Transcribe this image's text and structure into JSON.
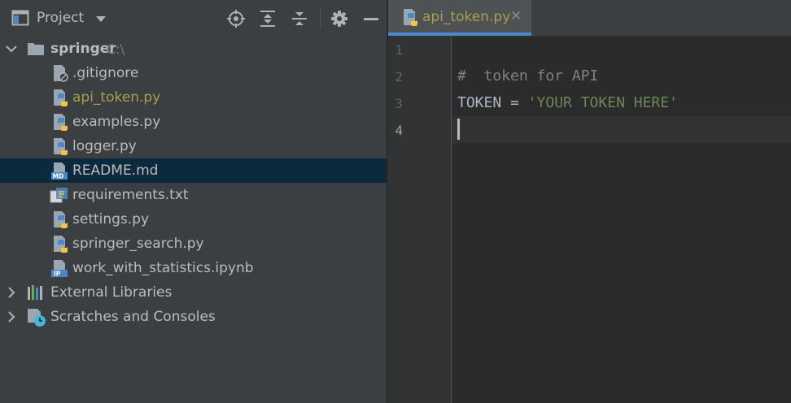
{
  "colors": {
    "panel_bg": "#3c3f41",
    "editor_bg": "#2b2b2b",
    "selection": "#0d293e",
    "modified_file": "#a7a04a",
    "tab_underline": "#4a88c7",
    "string": "#6a8759",
    "comment": "#808080"
  },
  "project_panel": {
    "title": "Project",
    "toolbar_icons": [
      "window-icon",
      "chevron-down-icon",
      "locate-icon",
      "expand-all-icon",
      "collapse-all-icon",
      "gear-icon",
      "minimize-icon"
    ]
  },
  "tree": {
    "root": {
      "name": "springer",
      "path": "C:\\"
    },
    "files": [
      {
        "name": ".gitignore",
        "icon": "gitignore-file-icon",
        "modified": false,
        "selected": false
      },
      {
        "name": "api_token.py",
        "icon": "python-file-icon",
        "modified": true,
        "selected": false
      },
      {
        "name": "examples.py",
        "icon": "python-file-icon",
        "modified": false,
        "selected": false
      },
      {
        "name": "logger.py",
        "icon": "python-file-icon",
        "modified": false,
        "selected": false
      },
      {
        "name": "README.md",
        "icon": "markdown-file-icon",
        "modified": false,
        "selected": true
      },
      {
        "name": "requirements.txt",
        "icon": "requirements-file-icon",
        "modified": false,
        "selected": false
      },
      {
        "name": "settings.py",
        "icon": "python-file-icon",
        "modified": false,
        "selected": false
      },
      {
        "name": "springer_search.py",
        "icon": "python-file-icon",
        "modified": false,
        "selected": false
      },
      {
        "name": "work_with_statistics.ipynb",
        "icon": "notebook-file-icon",
        "modified": false,
        "selected": false
      }
    ],
    "external_libraries": "External Libraries",
    "scratches": "Scratches and Consoles"
  },
  "editor": {
    "tab": {
      "label": "api_token.py",
      "close": "✕"
    },
    "line_numbers": [
      "1",
      "2",
      "3",
      "4"
    ],
    "current_line": 4,
    "code": {
      "line2": "#  token for API",
      "line3_ident": "TOKEN = ",
      "line3_string": "'YOUR TOKEN HERE'"
    }
  }
}
